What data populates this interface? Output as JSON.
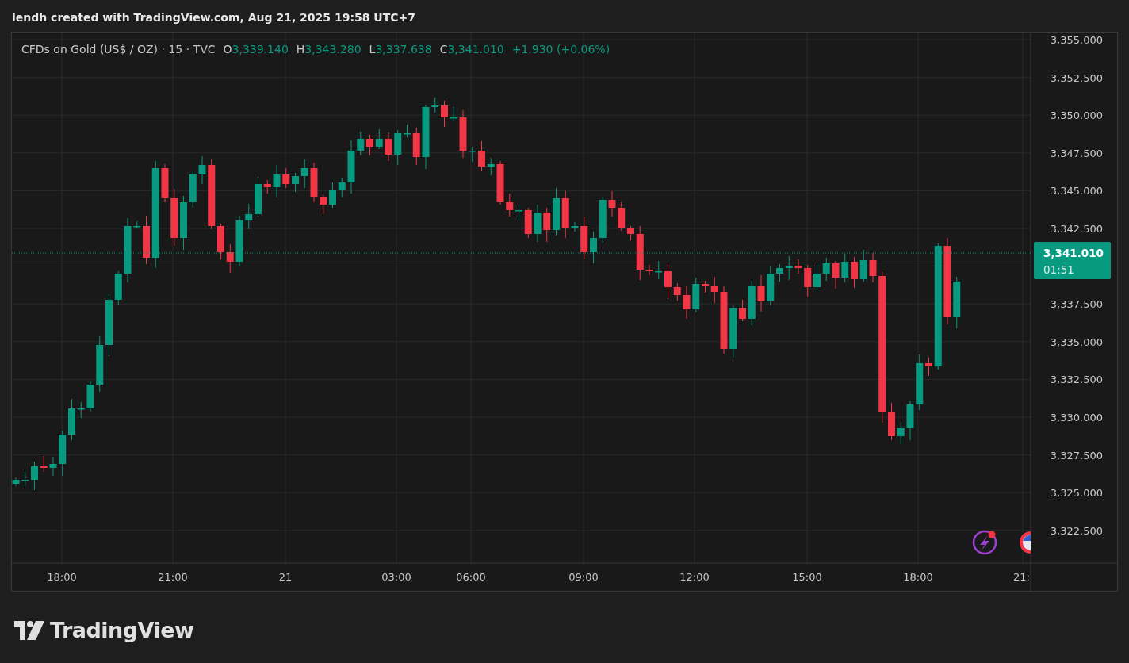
{
  "header": {
    "text": "lendh created with TradingView.com, Aug 21, 2025 19:58 UTC+7"
  },
  "legend": {
    "symbol": "CFDs on Gold (US$ / OZ) · 15 · TVC",
    "values": [
      {
        "label": "O",
        "value": "3,339.140"
      },
      {
        "label": "H",
        "value": "3,343.280"
      },
      {
        "label": "L",
        "value": "3,337.638"
      },
      {
        "label": "C",
        "value": "3,341.010"
      }
    ],
    "change": "+1.930 (+0.06%)"
  },
  "price_axis": [
    "3,355.000",
    "3,352.500",
    "3,350.000",
    "3,347.500",
    "3,345.000",
    "3,342.500",
    "3,337.500",
    "3,335.000",
    "3,332.500",
    "3,330.000",
    "3,327.500",
    "3,325.000",
    "3,322.500"
  ],
  "time_axis": [
    "18:00",
    "21:00",
    "21",
    "03:00",
    "06:00",
    "09:00",
    "12:00",
    "15:00",
    "18:00",
    "21:"
  ],
  "last_price": {
    "price": "3,341.010",
    "countdown": "01:51"
  },
  "logo": {
    "text": "TradingView"
  }
}
